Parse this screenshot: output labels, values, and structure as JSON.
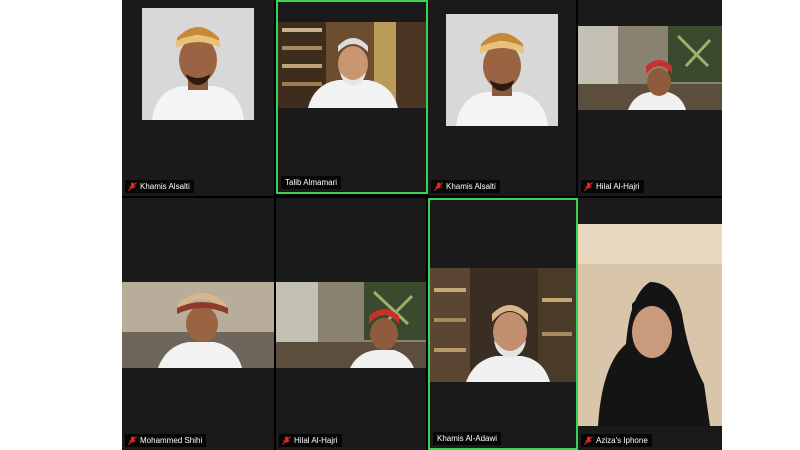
{
  "participants": [
    {
      "name": "Khamis Alsalti",
      "muted": true
    },
    {
      "name": "Talib Almamari",
      "muted": false
    },
    {
      "name": "Khamis Alsalti",
      "muted": true
    },
    {
      "name": "Hilal Al-Hajri",
      "muted": true
    },
    {
      "name": "Mohammed Shihi",
      "muted": true
    },
    {
      "name": "Hilal Al-Hajri",
      "muted": true
    },
    {
      "name": "Khamis Al-Adawi",
      "muted": false
    },
    {
      "name": "Aziza's Iphone",
      "muted": true
    }
  ],
  "colors": {
    "tile_bg": "#1a1a1a",
    "active_border": "#39d353",
    "muted_icon": "#e02b20"
  }
}
